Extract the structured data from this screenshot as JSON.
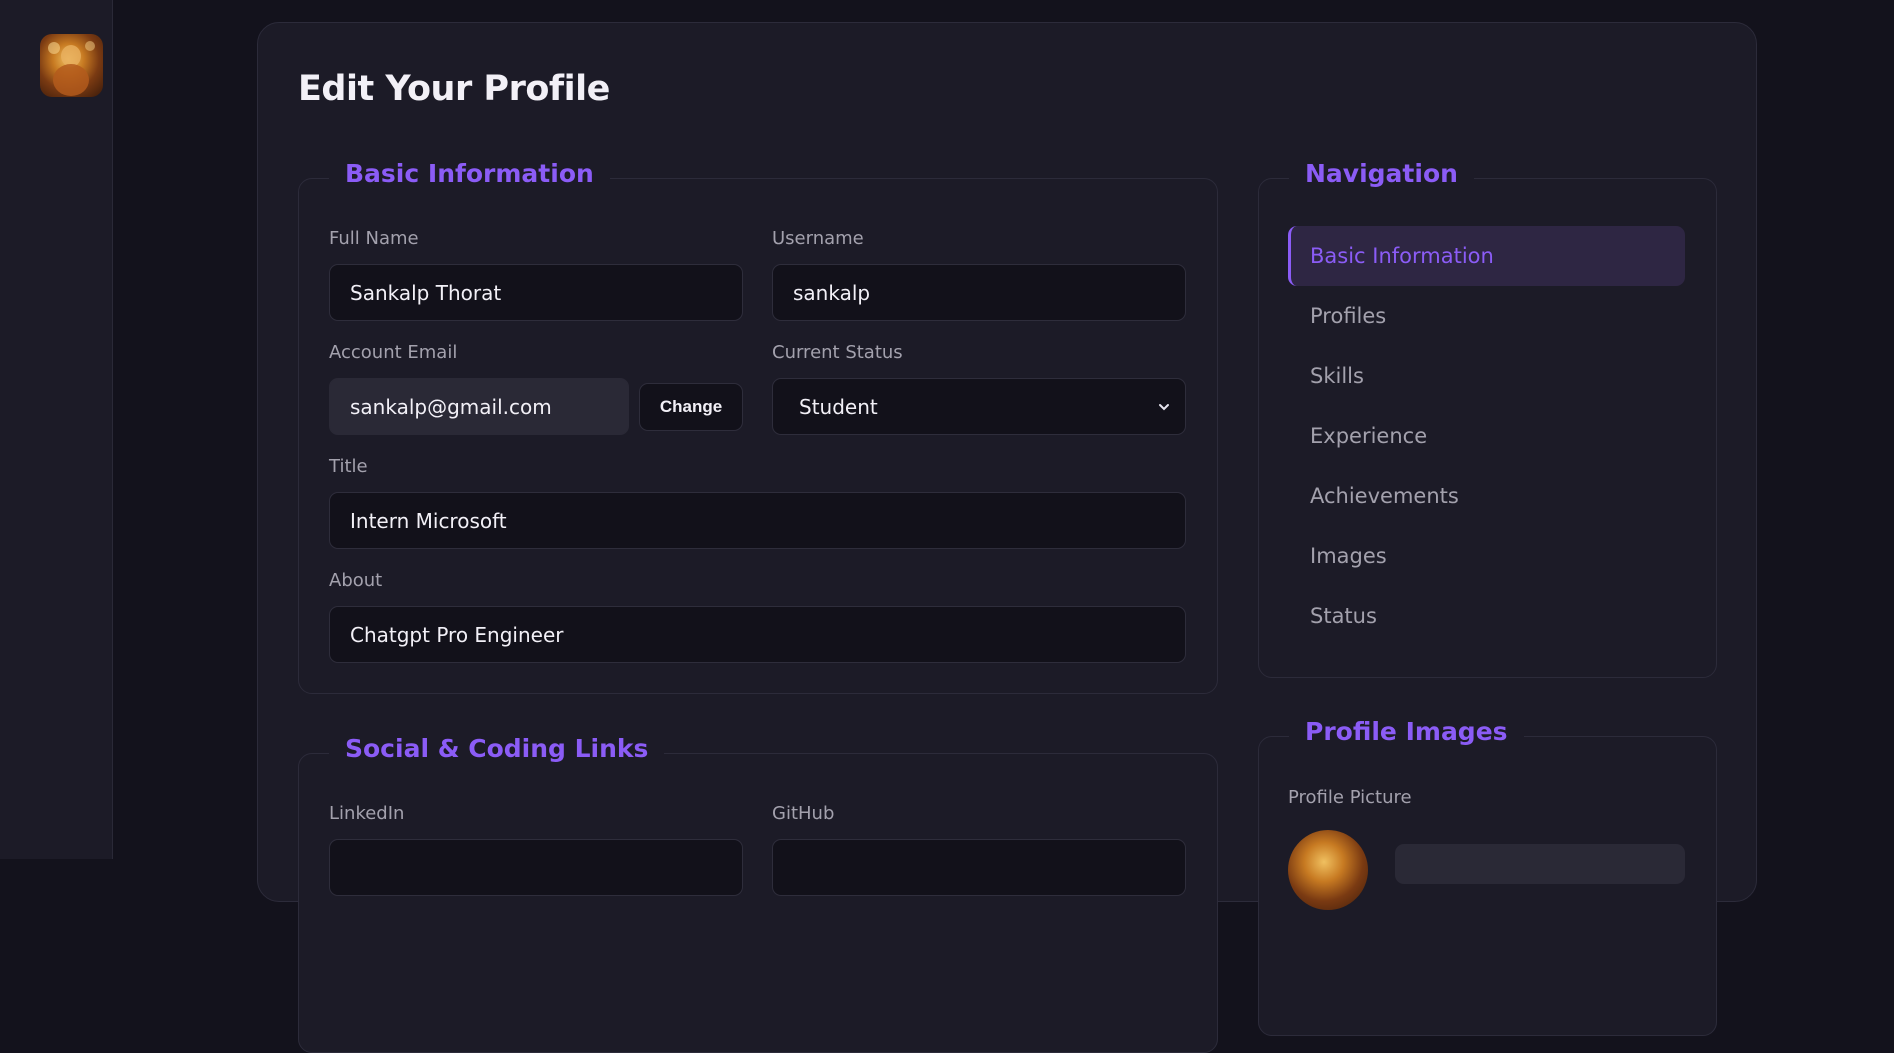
{
  "sidebar": {
    "avatar_icon": "user-avatar"
  },
  "page": {
    "title": "Edit Your Profile"
  },
  "basic": {
    "legend": "Basic Information",
    "full_name_label": "Full Name",
    "full_name_value": "Sankalp Thorat",
    "username_label": "Username",
    "username_value": "sankalp",
    "email_label": "Account Email",
    "email_value": "sankalp@gmail.com",
    "change_label": "Change",
    "status_label": "Current Status",
    "status_value": "Student",
    "title_label": "Title",
    "title_value": "Intern Microsoft",
    "about_label": "About",
    "about_value": "Chatgpt Pro Engineer"
  },
  "social": {
    "legend": "Social & Coding Links",
    "linkedin_label": "LinkedIn",
    "github_label": "GitHub"
  },
  "navigation": {
    "legend": "Navigation",
    "items": [
      {
        "label": "Basic Information",
        "active": true
      },
      {
        "label": "Profiles",
        "active": false
      },
      {
        "label": "Skills",
        "active": false
      },
      {
        "label": "Experience",
        "active": false
      },
      {
        "label": "Achievements",
        "active": false
      },
      {
        "label": "Images",
        "active": false
      },
      {
        "label": "Status",
        "active": false
      }
    ]
  },
  "images": {
    "legend": "Profile Images",
    "picture_label": "Profile Picture"
  },
  "colors": {
    "accent": "#8b5cf6",
    "background": "#13121c",
    "card": "#1c1b27",
    "input": "#12111a"
  }
}
